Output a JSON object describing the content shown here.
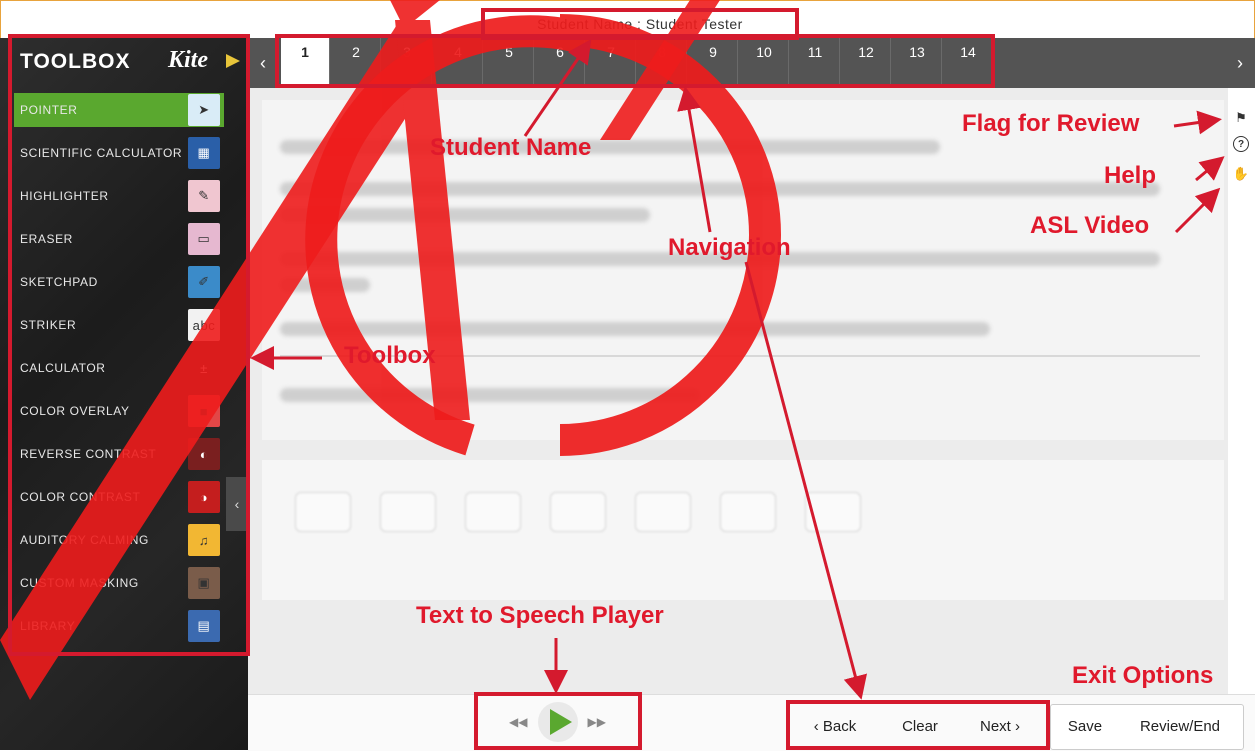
{
  "header": {
    "student_label": "Student Name : Student Tester"
  },
  "sidebar": {
    "title": "TOOLBOX",
    "logo": "Kite",
    "collapse_icon": "‹",
    "tools": [
      {
        "label": "POINTER",
        "icon": "pointer-icon",
        "glyph": "➤",
        "active": true
      },
      {
        "label": "SCIENTIFIC CALCULATOR",
        "icon": "scientific-calculator-icon",
        "glyph": "▦"
      },
      {
        "label": "HIGHLIGHTER",
        "icon": "highlighter-icon",
        "glyph": "✎"
      },
      {
        "label": "ERASER",
        "icon": "eraser-icon",
        "glyph": "▭"
      },
      {
        "label": "SKETCHPAD",
        "icon": "sketchpad-icon",
        "glyph": "✐"
      },
      {
        "label": "STRIKER",
        "icon": "striker-icon",
        "glyph": "abc"
      },
      {
        "label": "CALCULATOR",
        "icon": "calculator-icon",
        "glyph": "±"
      },
      {
        "label": "COLOR OVERLAY",
        "icon": "color-overlay-icon",
        "glyph": "■"
      },
      {
        "label": "REVERSE CONTRAST",
        "icon": "reverse-contrast-icon",
        "glyph": "◐"
      },
      {
        "label": "COLOR CONTRAST",
        "icon": "color-contrast-icon",
        "glyph": "◑"
      },
      {
        "label": "AUDITORY CALMING",
        "icon": "auditory-calming-icon",
        "glyph": "♫"
      },
      {
        "label": "CUSTOM MASKING",
        "icon": "custom-masking-icon",
        "glyph": "▣"
      },
      {
        "label": "LIBRARY",
        "icon": "library-icon",
        "glyph": "▤"
      }
    ]
  },
  "navigation": {
    "prev_glyph": "‹",
    "next_glyph": "›",
    "questions": [
      "1",
      "2",
      "3",
      "4",
      "5",
      "6",
      "7",
      "8",
      "9",
      "10",
      "11",
      "12",
      "13",
      "14"
    ],
    "current": "1"
  },
  "right_tools": [
    {
      "icon": "flag-icon",
      "glyph": "⚑"
    },
    {
      "icon": "help-icon",
      "glyph": "?"
    },
    {
      "icon": "asl-video-icon",
      "glyph": "✋"
    }
  ],
  "player": {
    "rewind_glyph": "◀◀",
    "forward_glyph": "▶▶"
  },
  "footer": {
    "back": "‹ Back",
    "clear": "Clear",
    "next": "Next ›",
    "save": "Save",
    "review_end": "Review/End"
  },
  "annotations": {
    "student_name": "Student Name",
    "navigation": "Navigation",
    "toolbox": "Toolbox",
    "flag_for_review": "Flag for Review",
    "help": "Help",
    "asl_video": "ASL Video",
    "text_to_speech": "Text to Speech Player",
    "exit_options": "Exit Options"
  },
  "colors": {
    "accent_green": "#5aa82f",
    "annotation_red": "#d41a2e",
    "nav_gray": "#545454"
  }
}
